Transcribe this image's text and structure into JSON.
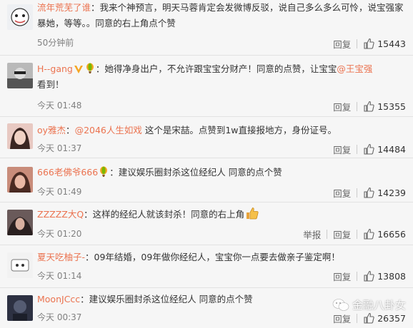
{
  "comments": [
    {
      "user": "流年荒芜了谁",
      "text": "：我来个神预言，明天马蓉肯定会发微博反驳，说自己多么多么可怜，说宝强家暴她，等等。。同意的右上角点个赞",
      "time": "50分钟前",
      "reply": "回复",
      "likes": "15443"
    },
    {
      "user": "H--gang",
      "text": "：她得净身出户，不允许跟宝宝分财产！同意的点赞，让宝宝",
      "mention": "@王宝强",
      "text_after": "看到！",
      "time": "今天 01:48",
      "reply": "回复",
      "likes": "15355"
    },
    {
      "user": "oy雅杰",
      "text_before": "：",
      "mention": "@2046人生如戏",
      "text": " 这个是宋喆。点赞到1w直接报地方，身份证号。",
      "time": "今天 01:37",
      "reply": "回复",
      "likes": "14484"
    },
    {
      "user": "666老佛爷666",
      "text": "：建议娱乐圈封杀这位经纪人 同意的点个赞",
      "time": "今天 01:49",
      "reply": "回复",
      "likes": "14239"
    },
    {
      "user": "ZZZZZ大Q",
      "text": "：这样的经纪人就该封杀！同意的右上角",
      "time": "今天 01:20",
      "report": "举报",
      "reply": "回复",
      "likes": "16656"
    },
    {
      "user": "夏天吃柚子-",
      "text": "：09年结婚，09年做你经纪人，宝宝你一点要去做亲子鉴定啊！",
      "time": "今天 01:14",
      "reply": "回复",
      "likes": "13808"
    },
    {
      "user": "MoonJCcc",
      "text": "：建议娱乐圈封杀这位经纪人 同意的点个赞",
      "time": "今天 00:37",
      "reply": "回复",
      "likes": "26357"
    }
  ],
  "watermark": "金融八卦女",
  "colors": {
    "username": "#eb7350",
    "time": "#808080",
    "background": "#f6f6f6"
  }
}
